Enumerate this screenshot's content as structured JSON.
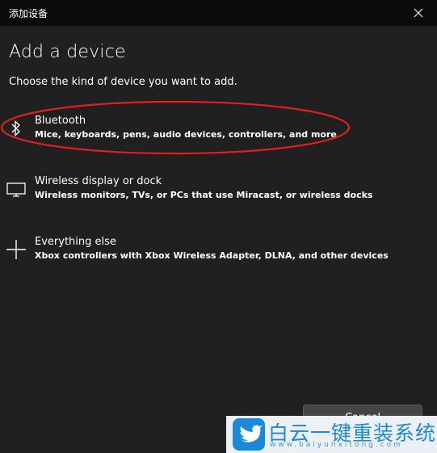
{
  "window": {
    "title": "添加设备",
    "close_icon": "close-icon"
  },
  "heading": "Add a device",
  "subheading": "Choose the kind of device you want to add.",
  "options": [
    {
      "icon": "bluetooth-icon",
      "name": "Bluetooth",
      "description": "Mice, keyboards, pens, audio devices, controllers, and more"
    },
    {
      "icon": "monitor-icon",
      "name": "Wireless display or dock",
      "description": "Wireless monitors, TVs, or PCs that use Miracast, or wireless docks"
    },
    {
      "icon": "plus-icon",
      "name": "Everything else",
      "description": "Xbox controllers with Xbox Wireless Adapter, DLNA, and other devices"
    }
  ],
  "buttons": {
    "cancel_label": "Cancel"
  },
  "watermark": {
    "brand": "白云一键重装系统",
    "url": "www.baiyunxitong.com"
  },
  "colors": {
    "background": "#202020",
    "titlebar": "#0b0b0b",
    "highlight_ellipse": "#e02020",
    "watermark_blue": "#1a8ad8"
  }
}
